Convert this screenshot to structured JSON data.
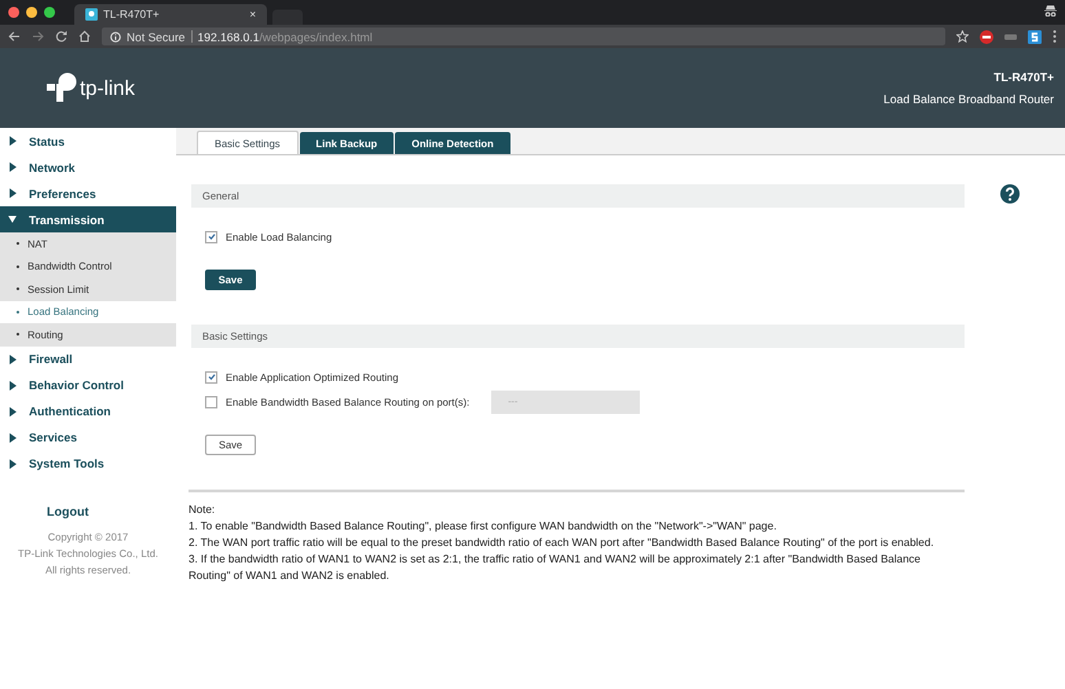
{
  "browser": {
    "tab_title": "TL-R470T+",
    "tab_close": "×",
    "security": "Not Secure",
    "url_host": "192.168.0.1",
    "url_path": "/webpages/index.html"
  },
  "header": {
    "brand": "tp-link",
    "model": "TL-R470T+",
    "product": "Load Balance Broadband Router"
  },
  "sidebar": {
    "items": [
      {
        "label": "Status",
        "expanded": false,
        "selected": false
      },
      {
        "label": "Network",
        "expanded": false,
        "selected": false
      },
      {
        "label": "Preferences",
        "expanded": false,
        "selected": false
      },
      {
        "label": "Transmission",
        "expanded": true,
        "selected": true,
        "children": [
          {
            "label": "NAT",
            "selected": false
          },
          {
            "label": "Bandwidth Control",
            "selected": false
          },
          {
            "label": "Session Limit",
            "selected": false
          },
          {
            "label": "Load Balancing",
            "selected": true
          },
          {
            "label": "Routing",
            "selected": false
          }
        ]
      },
      {
        "label": "Firewall",
        "expanded": false,
        "selected": false
      },
      {
        "label": "Behavior Control",
        "expanded": false,
        "selected": false
      },
      {
        "label": "Authentication",
        "expanded": false,
        "selected": false
      },
      {
        "label": "Services",
        "expanded": false,
        "selected": false
      },
      {
        "label": "System Tools",
        "expanded": false,
        "selected": false
      }
    ],
    "logout": "Logout",
    "copyright": [
      "Copyright © 2017",
      "TP-Link Technologies Co., Ltd.",
      "All rights reserved."
    ]
  },
  "tabs": [
    {
      "label": "Basic Settings",
      "selected": true
    },
    {
      "label": "Link Backup",
      "selected": false
    },
    {
      "label": "Online Detection",
      "selected": false
    }
  ],
  "sections": [
    {
      "title": "General",
      "options": [
        {
          "label": "Enable Load Balancing",
          "checked": true
        }
      ],
      "save": {
        "label": "Save",
        "primary": true
      }
    },
    {
      "title": "Basic Settings",
      "options": [
        {
          "label": "Enable Application Optimized Routing",
          "checked": true
        },
        {
          "label": "Enable Bandwidth Based Balance Routing on port(s):",
          "checked": false,
          "port_select": "---"
        }
      ],
      "save": {
        "label": "Save",
        "primary": false
      }
    }
  ],
  "note": {
    "title": "Note:",
    "lines": [
      "1. To enable \"Bandwidth Based Balance Routing\", please first configure WAN bandwidth on the \"Network\"->\"WAN\" page.",
      "2. The WAN port traffic ratio will be equal to the preset bandwidth ratio of each WAN port after \"Bandwidth Based Balance Routing\" of the port is enabled.",
      "3. If the bandwidth ratio of WAN1 to WAN2 is set as 2:1, the traffic ratio of WAN1 and WAN2 will be approximately 2:1 after \"Bandwidth Based Balance Routing\" of WAN1 and WAN2 is enabled."
    ]
  }
}
